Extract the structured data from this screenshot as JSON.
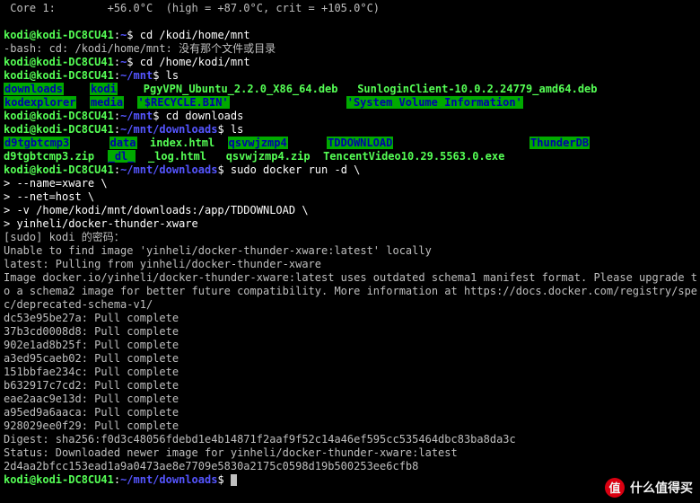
{
  "sensor": {
    "line": " Core 1:        +56.0°C  (high = +87.0°C, crit = +105.0°C)"
  },
  "prompt": {
    "user": "kodi@kodi-DC8CU41",
    "home": "~",
    "mnt": "~/mnt",
    "dl": "~/mnt/downloads",
    "suffix": "$ "
  },
  "cmds": {
    "cd_bad": "cd /kodi/home/mnt",
    "bash_err": "-bash: cd: /kodi/home/mnt: 没有那个文件或目录",
    "cd_mnt": "cd /home/kodi/mnt",
    "ls": "ls",
    "cd_dl": "cd downloads",
    "docker": "sudo docker run -d \\",
    "cont1": "> --name=xware \\",
    "cont2": "> --net=host \\",
    "cont3": "> -v /home/kodi/mnt/downloads:/app/TDDOWNLOAD \\",
    "cont4": "> yinheli/docker-thunder-xware"
  },
  "mnt_ls": {
    "r1": {
      "c1": "downloads",
      "c2": "kodi",
      "c3": "PgyVPN_Ubuntu_2.2.0_X86_64.deb",
      "c4": "SunloginClient-10.0.2.24779_amd64.deb"
    },
    "r2": {
      "c1": "kodexplorer",
      "c2": "media",
      "c3": "'$RECYCLE.BIN'",
      "c4": "'System Volume Information'"
    }
  },
  "dl_ls": {
    "r1": {
      "c1": "d9tgbtcmp3",
      "c2": "data",
      "c3": "index.html",
      "c4": "qsvwjzmp4",
      "c5": "TDDOWNLOAD",
      "c6": "ThunderDB"
    },
    "r2": {
      "c1": "d9tgbtcmp3.zip",
      "c2": "_dl_",
      "c3": "_log.html",
      "c4": "qsvwjzmp4.zip",
      "c5": "TencentVideo10.29.5563.0.exe"
    }
  },
  "sudo": "[sudo] kodi 的密码：",
  "docker_out": {
    "l1": "Unable to find image 'yinheli/docker-thunder-xware:latest' locally",
    "l2": "latest: Pulling from yinheli/docker-thunder-xware",
    "l3": "Image docker.io/yinheli/docker-thunder-xware:latest uses outdated schema1 manifest format. Please upgrade t",
    "l4": "o a schema2 image for better future compatibility. More information at https://docs.docker.com/registry/spe",
    "l5": "c/deprecated-schema-v1/",
    "p1": "dc53e95be27a: Pull complete",
    "p2": "37b3cd0008d8: Pull complete",
    "p3": "902e1ad8b25f: Pull complete",
    "p4": "a3ed95caeb02: Pull complete",
    "p5": "151bbfae234c: Pull complete",
    "p6": "b632917c7cd2: Pull complete",
    "p7": "eae2aac9e13d: Pull complete",
    "p8": "a95ed9a6aaca: Pull complete",
    "p9": "928029ee0f29: Pull complete",
    "digest": "Digest: sha256:f0d3c48056fdebd1e4b14871f2aaf9f52c14a46ef595cc535464dbc83ba8da3c",
    "status": "Status: Downloaded newer image for yinheli/docker-thunder-xware:latest",
    "cid": "2d4aa2bfcc153ead1a9a0473ae8e7709e5830a2175c0598d19b500253ee6cfb8"
  },
  "watermark": {
    "icon": "值",
    "text": "什么值得买"
  }
}
